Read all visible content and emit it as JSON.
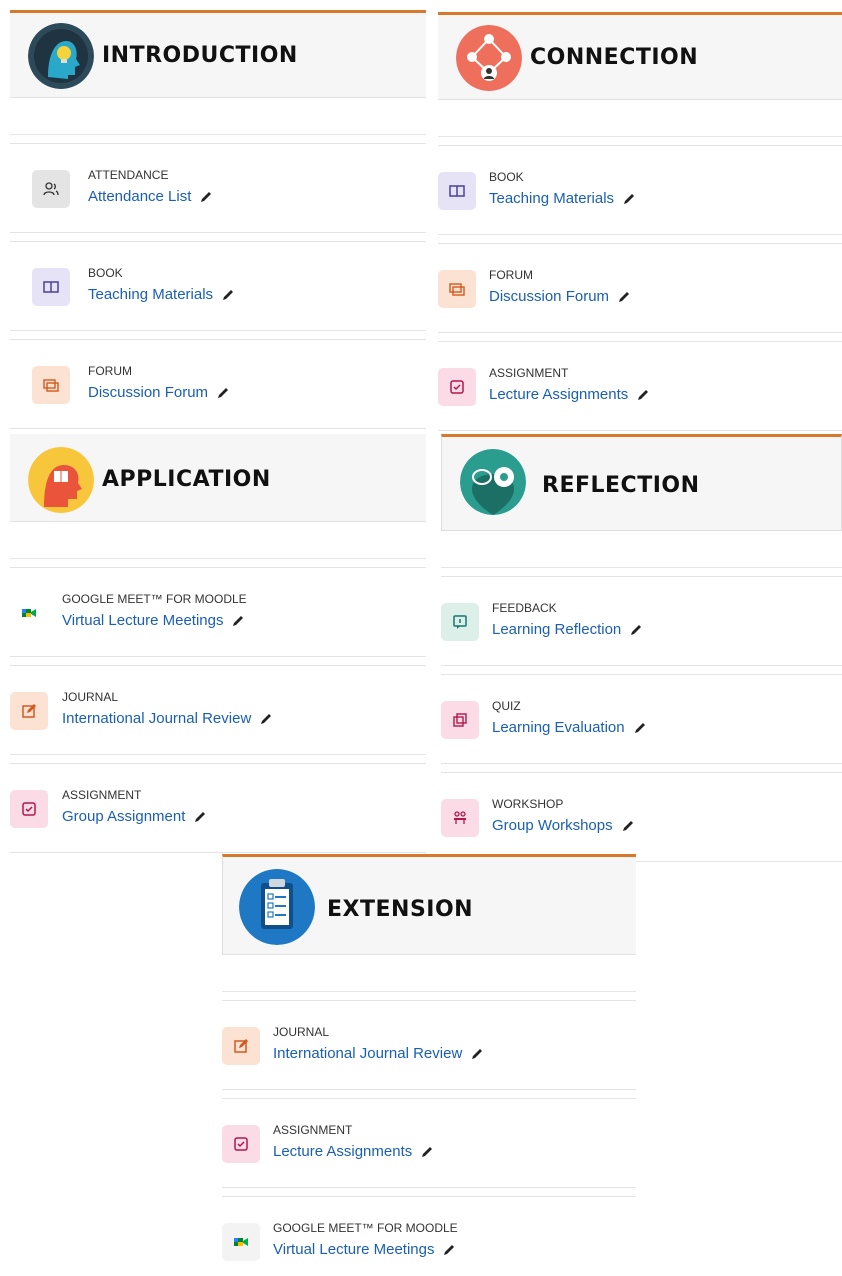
{
  "sections": {
    "introduction": {
      "title": "INTRODUCTION",
      "items": [
        {
          "type": "ATTENDANCE",
          "name": "Attendance List"
        },
        {
          "type": "BOOK",
          "name": "Teaching Materials"
        },
        {
          "type": "FORUM",
          "name": "Discussion Forum"
        }
      ]
    },
    "connection": {
      "title": "CONNECTION",
      "items": [
        {
          "type": "BOOK",
          "name": "Teaching Materials"
        },
        {
          "type": "FORUM",
          "name": "Discussion Forum"
        },
        {
          "type": "ASSIGNMENT",
          "name": "Lecture Assignments"
        }
      ]
    },
    "application": {
      "title": "APPLICATION",
      "items": [
        {
          "type": "GOOGLE MEET™ FOR MOODLE",
          "name": "Virtual Lecture Meetings"
        },
        {
          "type": "JOURNAL",
          "name": "International Journal Review"
        },
        {
          "type": "ASSIGNMENT",
          "name": "Group Assignment"
        }
      ]
    },
    "reflection": {
      "title": "REFLECTION",
      "items": [
        {
          "type": "FEEDBACK",
          "name": "Learning Reflection"
        },
        {
          "type": "QUIZ",
          "name": "Learning Evaluation"
        },
        {
          "type": "WORKSHOP",
          "name": "Group Workshops"
        }
      ]
    },
    "extension": {
      "title": "EXTENSION",
      "items": [
        {
          "type": "JOURNAL",
          "name": "International Journal Review"
        },
        {
          "type": "ASSIGNMENT",
          "name": "Lecture Assignments"
        },
        {
          "type": "GOOGLE MEET™ FOR MOODLE",
          "name": "Virtual Lecture Meetings"
        }
      ]
    }
  },
  "colors": {
    "accent": "#d9782b",
    "link": "#1a5fb4"
  }
}
